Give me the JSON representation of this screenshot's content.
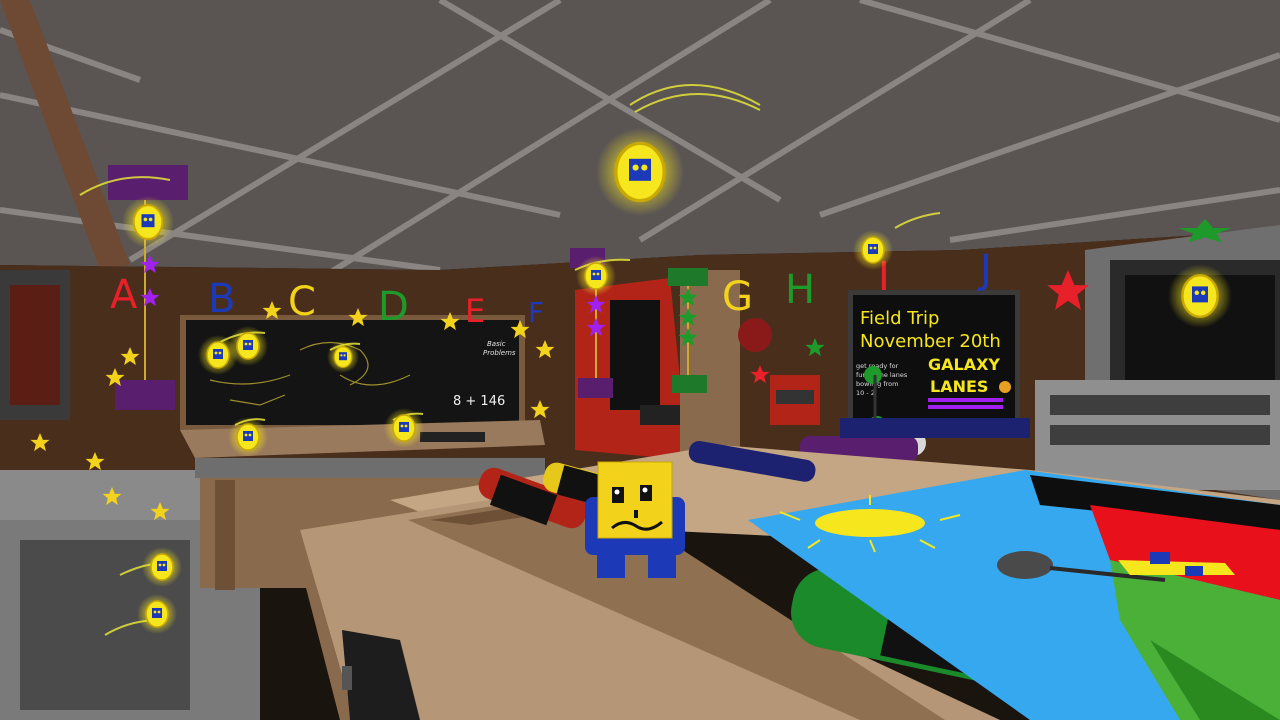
{
  "scene": "classroom",
  "alphabet_banner": {
    "letters": [
      {
        "char": "A",
        "color": "#e8202a"
      },
      {
        "char": "B",
        "color": "#1c3ab8"
      },
      {
        "char": "C",
        "color": "#f2d21a"
      },
      {
        "char": "D",
        "color": "#1e9a2a"
      },
      {
        "char": "E",
        "color": "#e8202a"
      },
      {
        "char": "F",
        "color": "#1c3ab8"
      },
      {
        "char": "G",
        "color": "#f2d21a"
      },
      {
        "char": "H",
        "color": "#1e9a2a"
      },
      {
        "char": "I",
        "color": "#e8202a"
      },
      {
        "char": "J",
        "color": "#1c3ab8"
      }
    ]
  },
  "chalkboard": {
    "heading_line1": "Basic",
    "heading_line2": "Problems",
    "equation": "8 + 146"
  },
  "field_trip_board": {
    "title": "Field Trip",
    "date": "November 20th",
    "blurb_line1": "get ready for",
    "blurb_line2": "fun at the lanes",
    "blurb_line3": "bowling from",
    "blurb_line4": "10 - 2",
    "venue_line1": "GALAXY",
    "venue_line2": "LANES"
  },
  "colors": {
    "ceiling": "#5a5553",
    "ceiling_beam": "#8a8583",
    "wall": "#4a2e1c",
    "desk": "#b59676",
    "chalkboard": "#141414",
    "coin": "#f5e61e",
    "star_yellow": "#f2d21a",
    "star_purple": "#a020f0",
    "star_red": "#e8202a",
    "star_green": "#1e9a2a"
  },
  "icons": [
    "coin-icon",
    "star-icon",
    "robot-character"
  ]
}
